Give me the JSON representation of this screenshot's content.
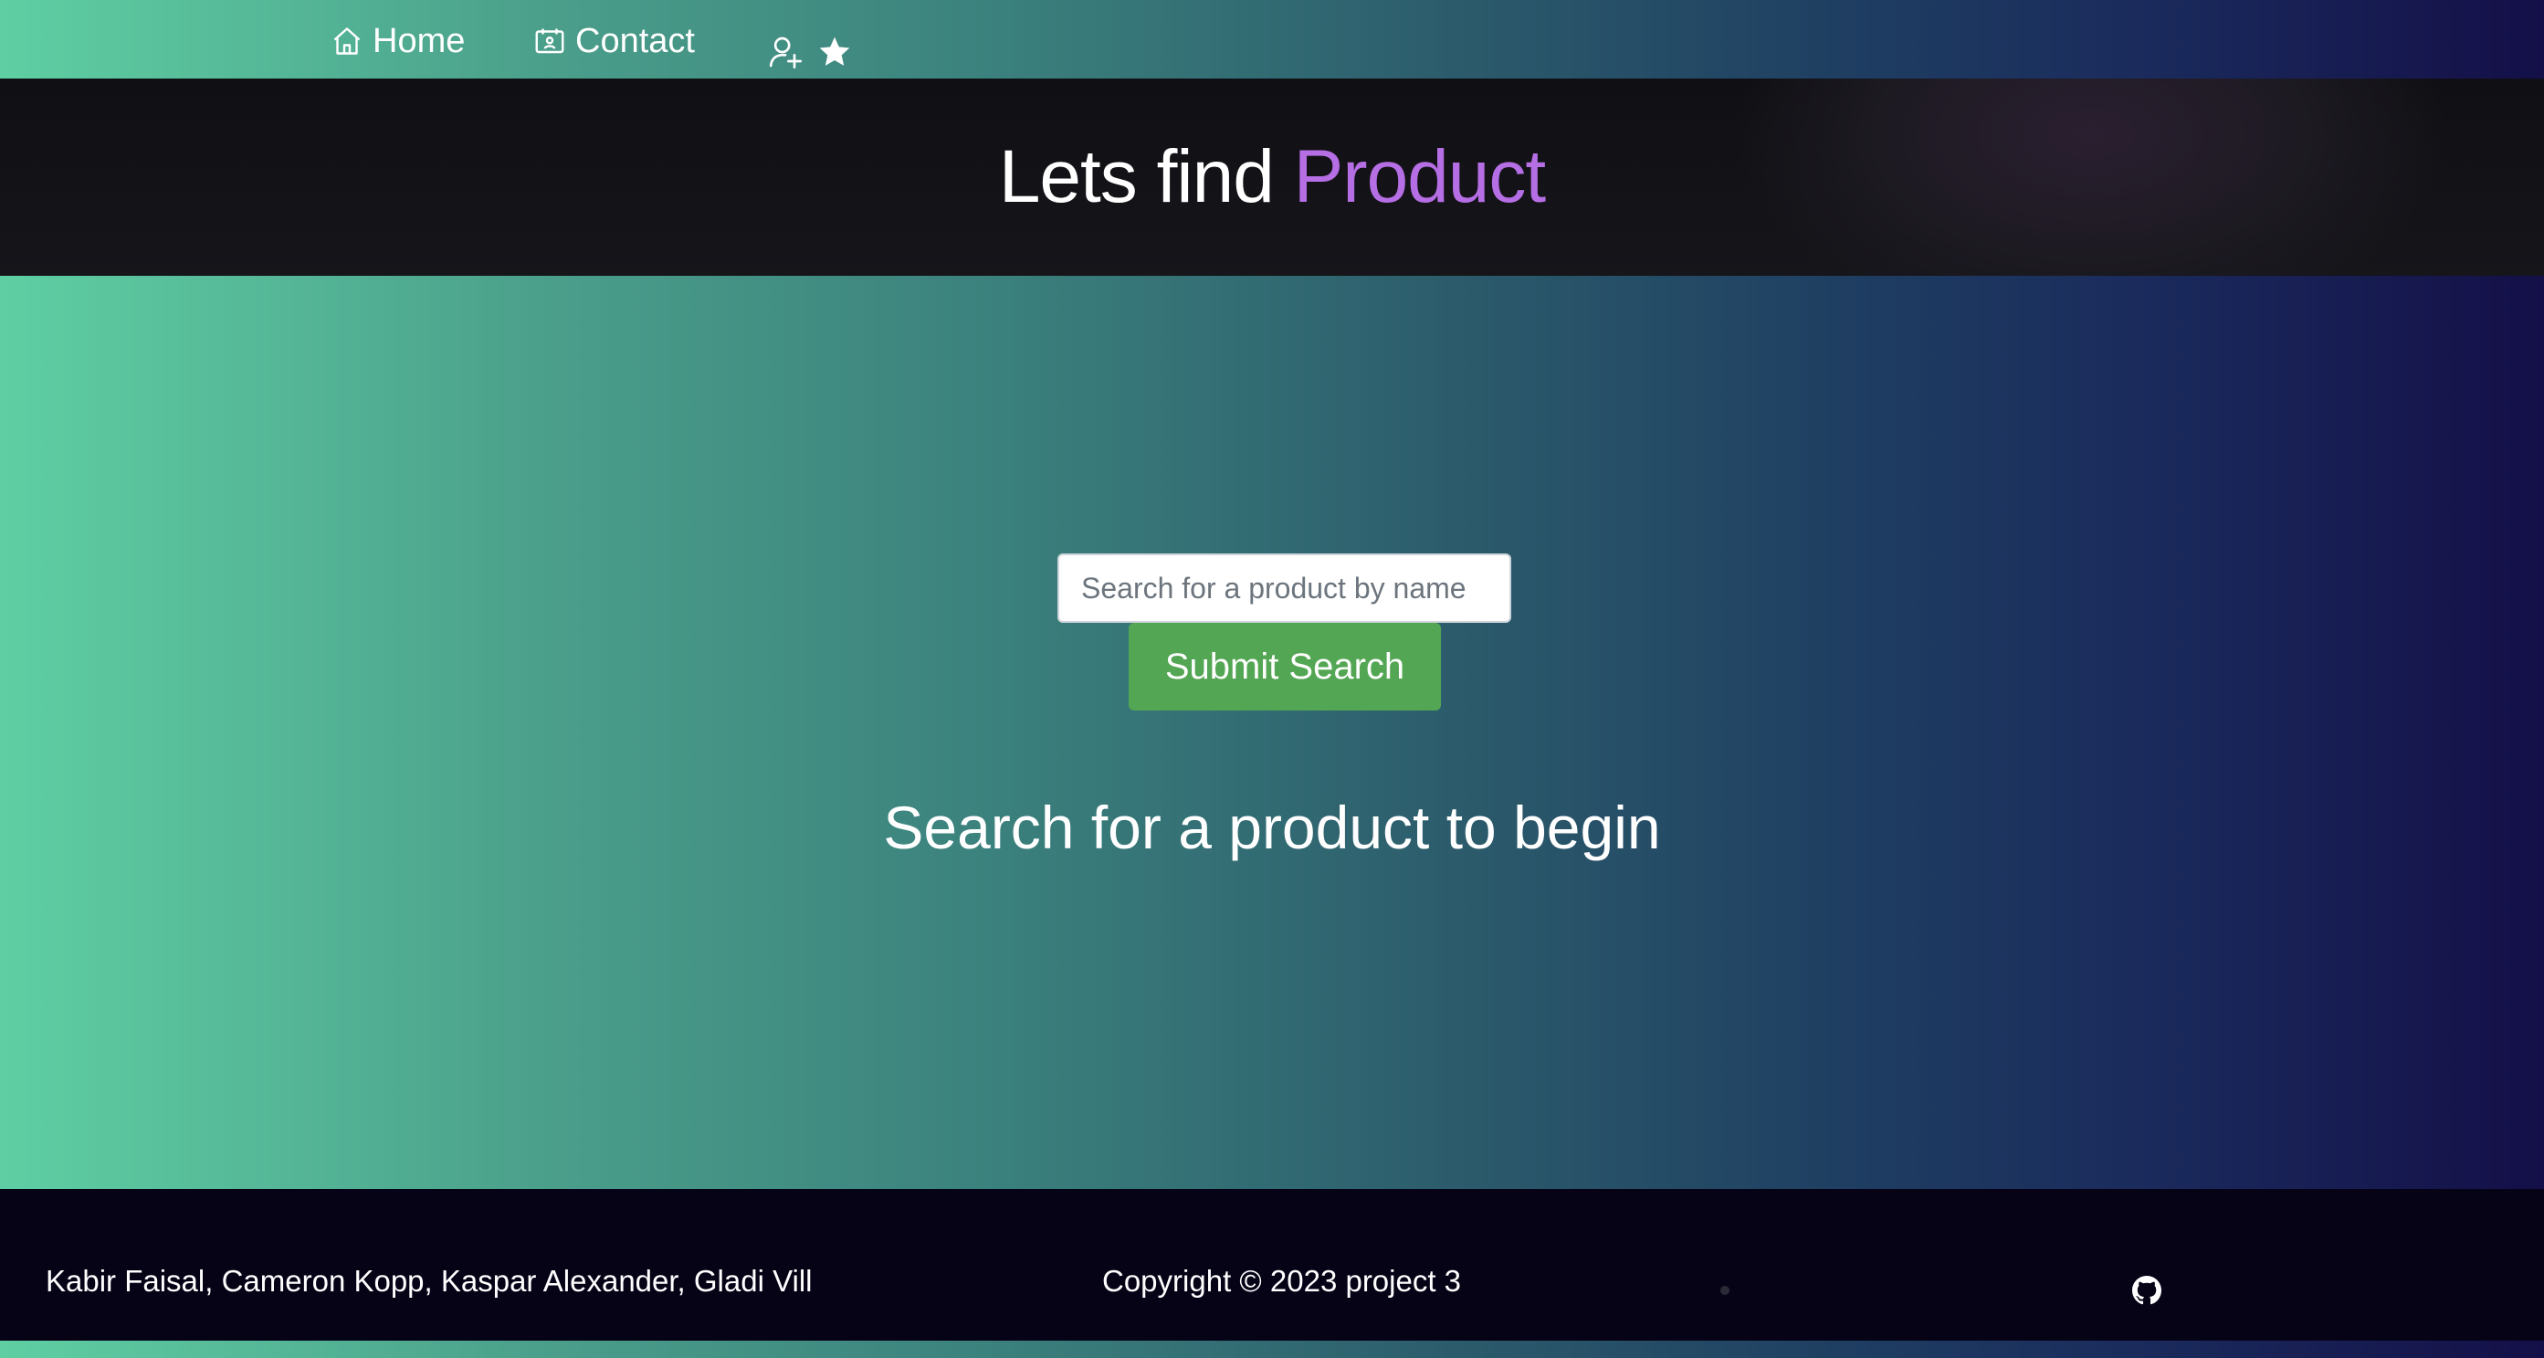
{
  "nav": {
    "home_label": "Home",
    "contact_label": "Contact"
  },
  "hero": {
    "title_prefix": "Lets find ",
    "title_accent": "Product",
    "accent_color": "#b56ee4"
  },
  "search": {
    "placeholder": "Search for a product by name",
    "submit_label": "Submit Search",
    "empty_message": "Search for a product to begin",
    "button_color": "#53a653"
  },
  "footer": {
    "authors": "Kabir Faisal, Cameron Kopp, Kaspar Alexander, Gladi Vill",
    "copyright": "Copyright © 2023 project 3"
  },
  "icons": {
    "home": "home-icon",
    "contact": "contact-card-icon",
    "signup": "user-plus-icon",
    "favorites": "star-icon",
    "github": "github-icon"
  }
}
